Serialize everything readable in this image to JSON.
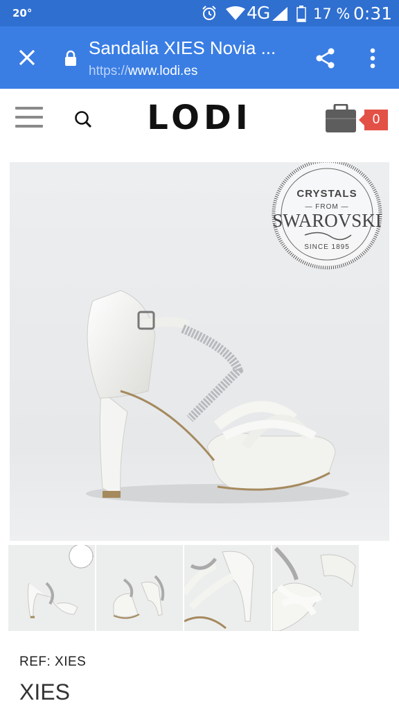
{
  "status_bar": {
    "temperature": "20°",
    "network": "4G",
    "battery": "17 %",
    "time": "0:31",
    "icons": [
      "alarm-icon",
      "wifi-icon",
      "cell-signal-icon",
      "battery-icon"
    ]
  },
  "browser": {
    "page_title": "Sandalia XIES Novia ...",
    "url_scheme": "https://",
    "url_host": "www.lodi.es",
    "icons": [
      "close-icon",
      "lock-icon",
      "share-icon",
      "more-vert-icon"
    ]
  },
  "site": {
    "logo": "LODI",
    "cart_count": "0",
    "icons": [
      "menu-icon",
      "search-icon",
      "shopping-bag-icon"
    ]
  },
  "badge": {
    "line1": "CRYSTALS",
    "line2": "— FROM —",
    "line3": "SWAROVSKI",
    "line4": "SINCE 1895"
  },
  "product": {
    "ref": "REF: XIES",
    "name": "XIES"
  },
  "colors": {
    "status_bar": "#2f6fd0",
    "toolbar": "#3a7ee4",
    "cart_badge": "#e35046",
    "image_background": "#e9eaec"
  }
}
